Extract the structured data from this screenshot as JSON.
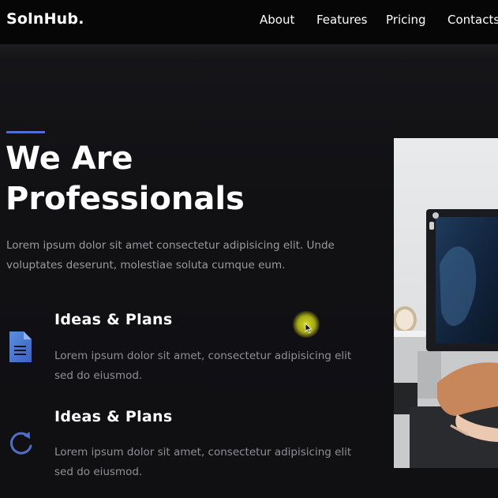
{
  "header": {
    "brand": "SolnHub.",
    "nav": [
      "About",
      "Features",
      "Pricing",
      "Contacts"
    ]
  },
  "hero": {
    "title_line1": "We Are",
    "title_line2": "Professionals",
    "description": "Lorem ipsum dolor sit amet consectetur adipisicing elit. Unde voluptates deserunt, molestiae soluta cumque eum."
  },
  "features": [
    {
      "title": "Ideas & Plans",
      "text": "Lorem ipsum dolor sit amet, consectetur adipisicing elit sed do eiusmod.",
      "icon": "document-icon"
    },
    {
      "title": "Ideas & Plans",
      "text": "Lorem ipsum dolor sit amet, consectetur adipisicing elit sed do eiusmod.",
      "icon": "refresh-icon"
    }
  ],
  "colors": {
    "background": "#111114",
    "header": "#060607",
    "accent": "#4f6fd0",
    "body_text": "#9a9aa0"
  }
}
